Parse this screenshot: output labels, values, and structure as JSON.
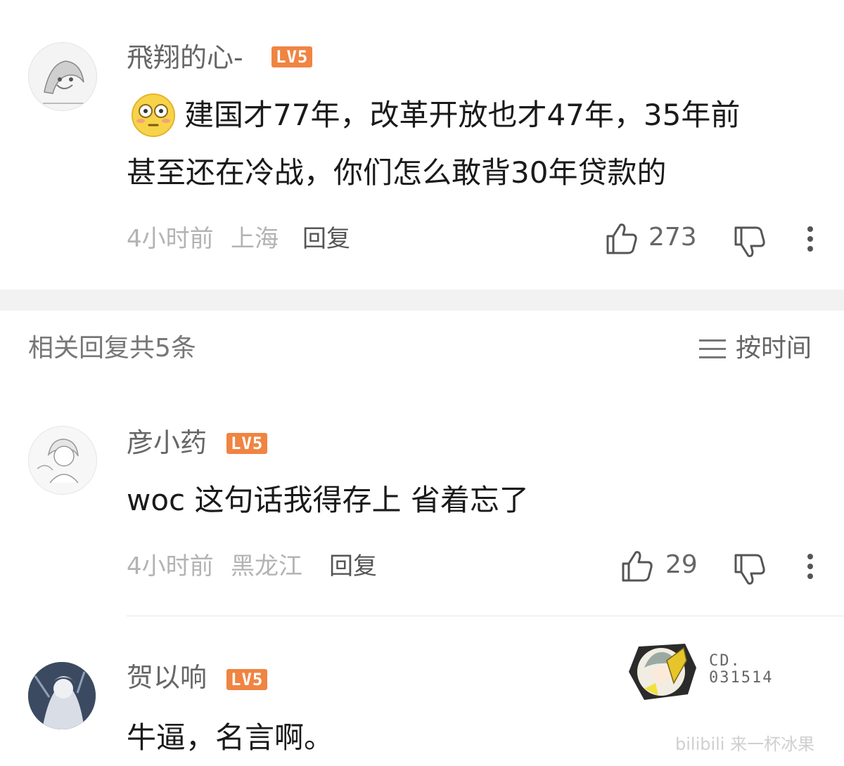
{
  "comment": {
    "username": "飛翔的心-",
    "level": "LV5",
    "emoji": "😳",
    "text_line1": "建国才77年，改革开放也才47年，35年前",
    "text_line2": "甚至还在冷战，你们怎么敢背30年贷款的",
    "time": "4小时前",
    "location": "上海",
    "reply_label": "回复",
    "likes": "273"
  },
  "replies_header": {
    "title": "相关回复共5条",
    "sort_label": "按时间"
  },
  "replies": [
    {
      "username": "彦小药",
      "level": "LV5",
      "text": "woc 这句话我得存上 省着忘了",
      "time": "4小时前",
      "location": "黑龙江",
      "reply_label": "回复",
      "likes": "29"
    },
    {
      "username": "贺以响",
      "level": "LV5",
      "text": "牛逼，名言啊。"
    }
  ],
  "badge": {
    "line1": "CD.",
    "line2": "031514"
  },
  "watermark": "bilibili 来一杯冰果",
  "colors": {
    "level_badge": "#f08442",
    "meta_text": "#b3b3b3",
    "divider_band": "#f2f2f2"
  }
}
